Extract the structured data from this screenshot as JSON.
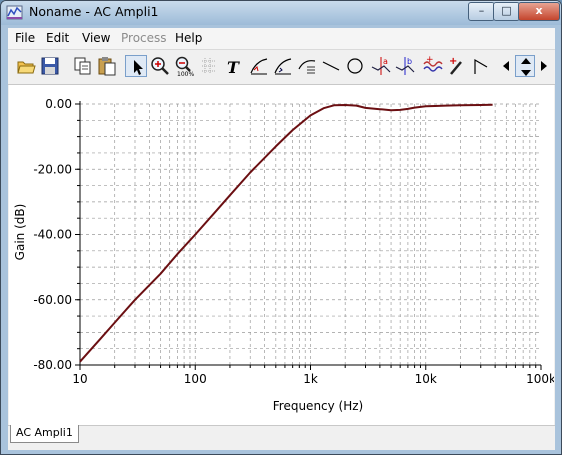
{
  "window": {
    "title": "Noname - AC Ampli1",
    "min": "–",
    "max": "□",
    "close": "x"
  },
  "menu": {
    "file": "File",
    "edit": "Edit",
    "view": "View",
    "process": "Process",
    "help": "Help"
  },
  "toolbar": {
    "text_tool": "T",
    "marker_a": "a",
    "marker_b": "b"
  },
  "icons": [
    "open-icon",
    "save-icon",
    "copy-icon",
    "paste-icon",
    "pointer-icon",
    "zoom-in-icon",
    "zoom-out-icon",
    "grid-icon",
    "text-icon",
    "curve-add-icon",
    "curve-edit-icon",
    "curve-data-icon",
    "line-icon",
    "ellipse-icon",
    "cursor-a-icon",
    "cursor-b-icon",
    "waveform-icon",
    "pick-icon",
    "flag-icon",
    "left-arrow-icon",
    "up-down-arrow-icon",
    "right-arrow-icon"
  ],
  "colors": {
    "curve": "#6b0f12",
    "grid": "#9a9a9a"
  },
  "tab": "AC Ampli1",
  "chart_data": {
    "type": "line",
    "xscale": "log",
    "xlim": [
      10,
      100000
    ],
    "ylim": [
      -80,
      0
    ],
    "xlabel": "Frequency (Hz)",
    "ylabel": "Gain (dB)",
    "x_ticks": [
      "10",
      "100",
      "1k",
      "10k",
      "100k"
    ],
    "y_ticks": [
      "0.00",
      "-20.00",
      "-40.00",
      "-60.00",
      "-80.00"
    ],
    "grid": true,
    "series": [
      {
        "x": [
          10,
          15,
          20,
          30,
          50,
          70,
          100,
          150,
          200,
          300,
          500,
          700,
          1000,
          1300,
          1600,
          2000,
          2500,
          3000,
          4000,
          5000,
          6000,
          7000,
          8000,
          10000,
          12000,
          15000,
          20000,
          30000,
          38000
        ],
        "y": [
          -79,
          -72,
          -67,
          -60,
          -52,
          -46,
          -40,
          -33,
          -28,
          -21,
          -13,
          -8,
          -3.5,
          -1.3,
          -0.4,
          -0.3,
          -0.5,
          -1.2,
          -1.6,
          -1.9,
          -1.8,
          -1.5,
          -1.1,
          -0.7,
          -0.6,
          -0.5,
          -0.4,
          -0.3,
          -0.25
        ]
      }
    ]
  }
}
